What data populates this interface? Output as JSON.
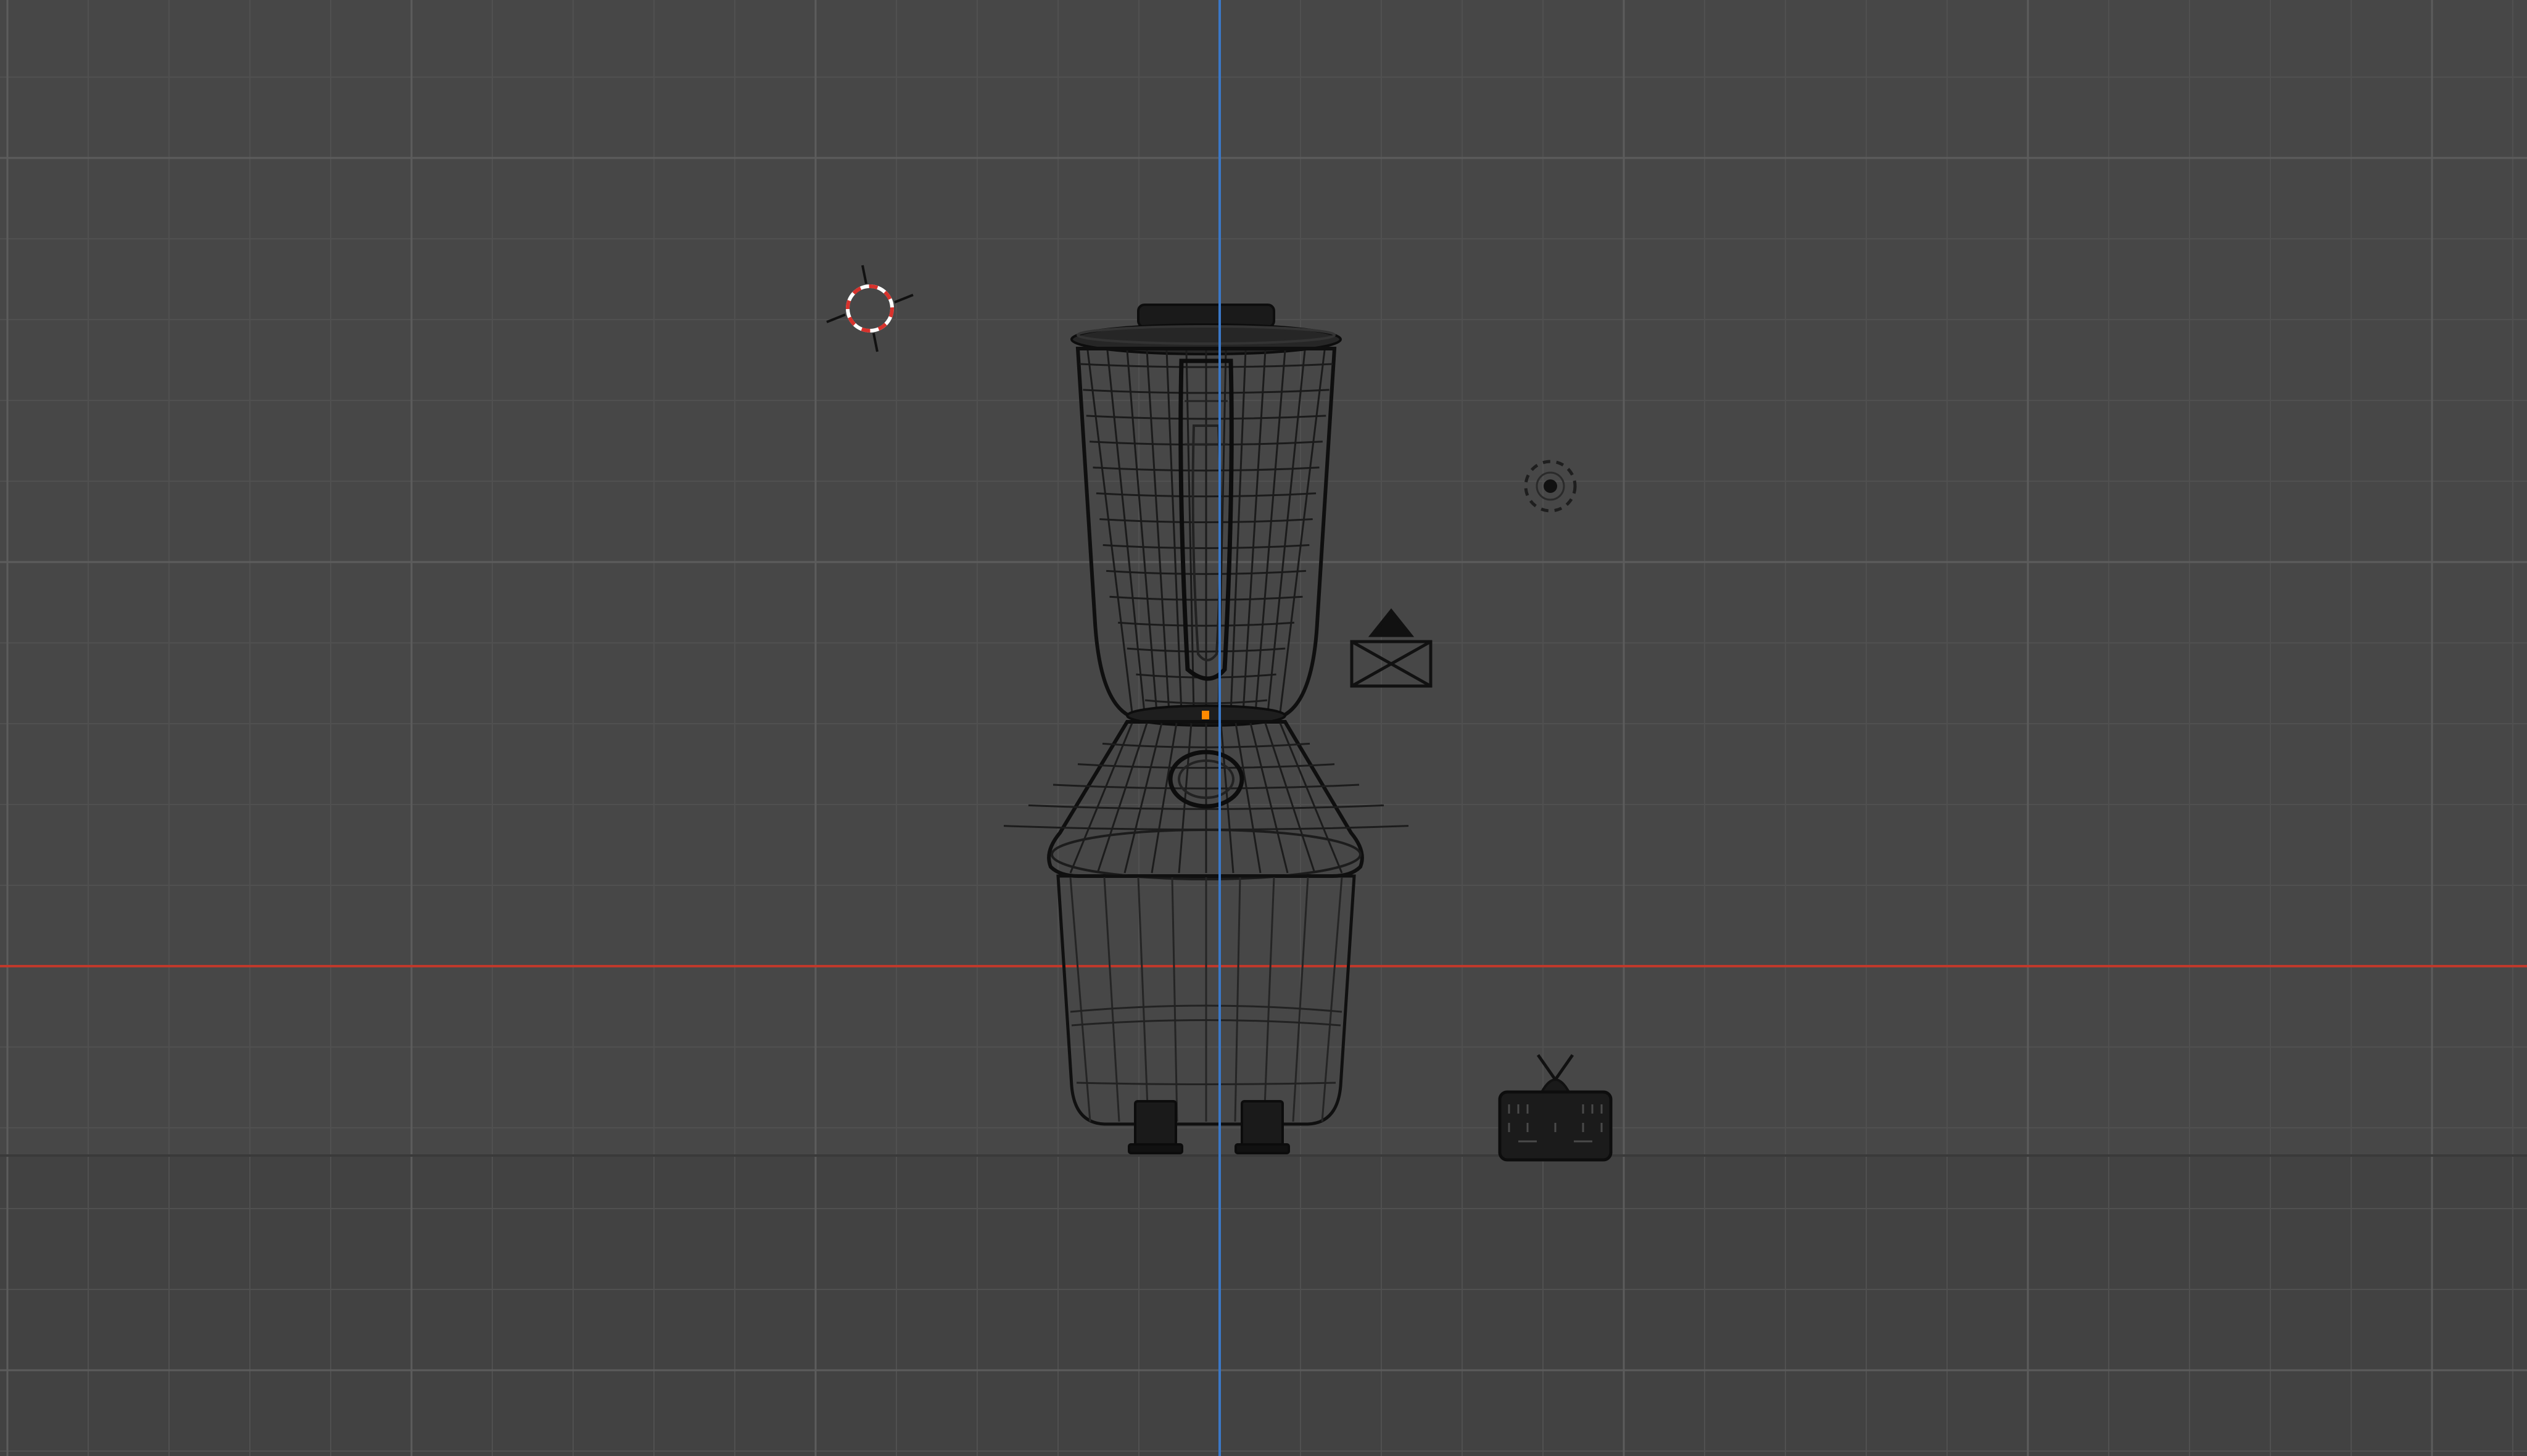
{
  "viewport": {
    "view": "front-orthographic",
    "shading": "wireframe",
    "background_color": "#474747",
    "grid": {
      "visible": true,
      "minor_color": "#505050",
      "major_color": "#5c5c5c"
    },
    "axes": {
      "x_axis_color": "#c0392b",
      "z_axis_color": "#3a78c8"
    },
    "wire_color": "#111111"
  },
  "scene": {
    "objects": [
      {
        "name": "blender-model",
        "type": "mesh",
        "selected": false,
        "origin_color": "#ff8a00"
      },
      {
        "name": "camera",
        "type": "camera",
        "icon": "camera-icon"
      },
      {
        "name": "light",
        "type": "light",
        "icon": "light-icon"
      },
      {
        "name": "speaker",
        "type": "speaker",
        "icon": "speaker-icon"
      },
      {
        "name": "3d-cursor",
        "type": "cursor",
        "icon": "3d-cursor-icon"
      }
    ]
  }
}
